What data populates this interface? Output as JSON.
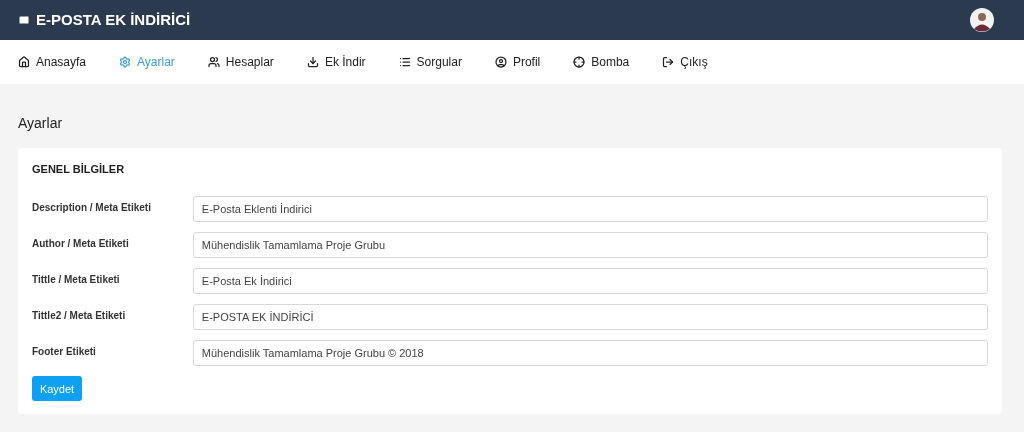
{
  "header": {
    "title": "E-POSTA EK İNDİRİCİ"
  },
  "nav": [
    {
      "label": "Anasayfa",
      "kind": "home",
      "selected": false
    },
    {
      "label": "Ayarlar",
      "kind": "settings",
      "selected": true
    },
    {
      "label": "Hesaplar",
      "kind": "users",
      "selected": false
    },
    {
      "label": "Ek İndir",
      "kind": "download",
      "selected": false
    },
    {
      "label": "Sorgular",
      "kind": "list",
      "selected": false
    },
    {
      "label": "Profil",
      "kind": "profile",
      "selected": false
    },
    {
      "label": "Bomba",
      "kind": "target",
      "selected": false
    },
    {
      "label": "Çıkış",
      "kind": "logout",
      "selected": false
    }
  ],
  "page_title": "Ayarlar",
  "card": {
    "title": "GENEL BİLGİLER",
    "fields": [
      {
        "label": "Description / Meta Etiketi",
        "value": "E-Posta Eklenti İndirici"
      },
      {
        "label": "Author / Meta Etiketi",
        "value": "Mühendislik Tamamlama Proje Grubu"
      },
      {
        "label": "Tittle / Meta Etiketi",
        "value": "E-Posta Ek İndirici"
      },
      {
        "label": "Tittle2 / Meta Etiketi",
        "value": "E-POSTA EK İNDİRİCİ"
      },
      {
        "label": "Footer Etiketi",
        "value": "Mühendislik Tamamlama Proje Grubu © 2018"
      }
    ],
    "button": "Kaydet"
  }
}
